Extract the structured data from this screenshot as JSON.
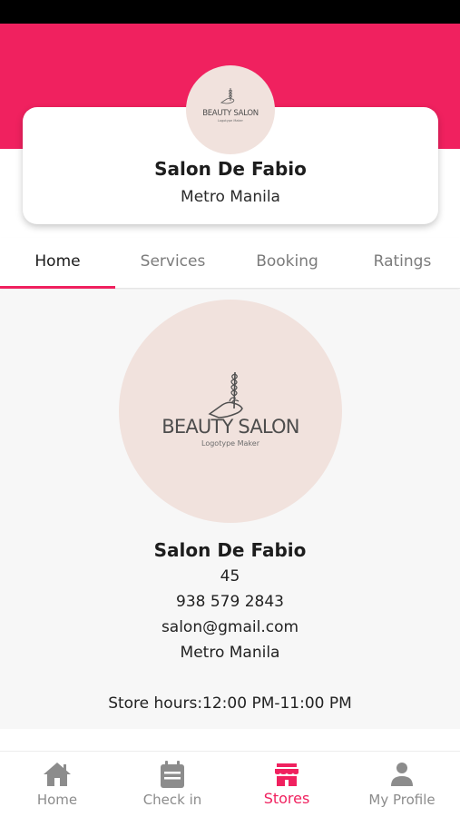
{
  "colors": {
    "accent": "#f0215f",
    "logo_bg": "#f1e2dd",
    "inactive": "#8c8c8c"
  },
  "header": {
    "logo": {
      "word": "BEAUTY SALON",
      "tagline": "Logotype Maker"
    },
    "store_name": "Salon De Fabio",
    "location": "Metro Manila"
  },
  "tabs": [
    {
      "label": "Home",
      "active": true
    },
    {
      "label": "Services",
      "active": false
    },
    {
      "label": "Booking",
      "active": false
    },
    {
      "label": "Ratings",
      "active": false
    }
  ],
  "details": {
    "name": "Salon De Fabio",
    "number": "45",
    "phone": "938 579 2843",
    "email": "salon@gmail.com",
    "location": "Metro Manila",
    "hours": "Store hours:12:00 PM-11:00 PM"
  },
  "bottom_nav": [
    {
      "label": "Home",
      "icon": "home-icon",
      "active": false
    },
    {
      "label": "Check in",
      "icon": "calendar-icon",
      "active": false
    },
    {
      "label": "Stores",
      "icon": "store-icon",
      "active": true
    },
    {
      "label": "My Profile",
      "icon": "person-icon",
      "active": false
    }
  ]
}
